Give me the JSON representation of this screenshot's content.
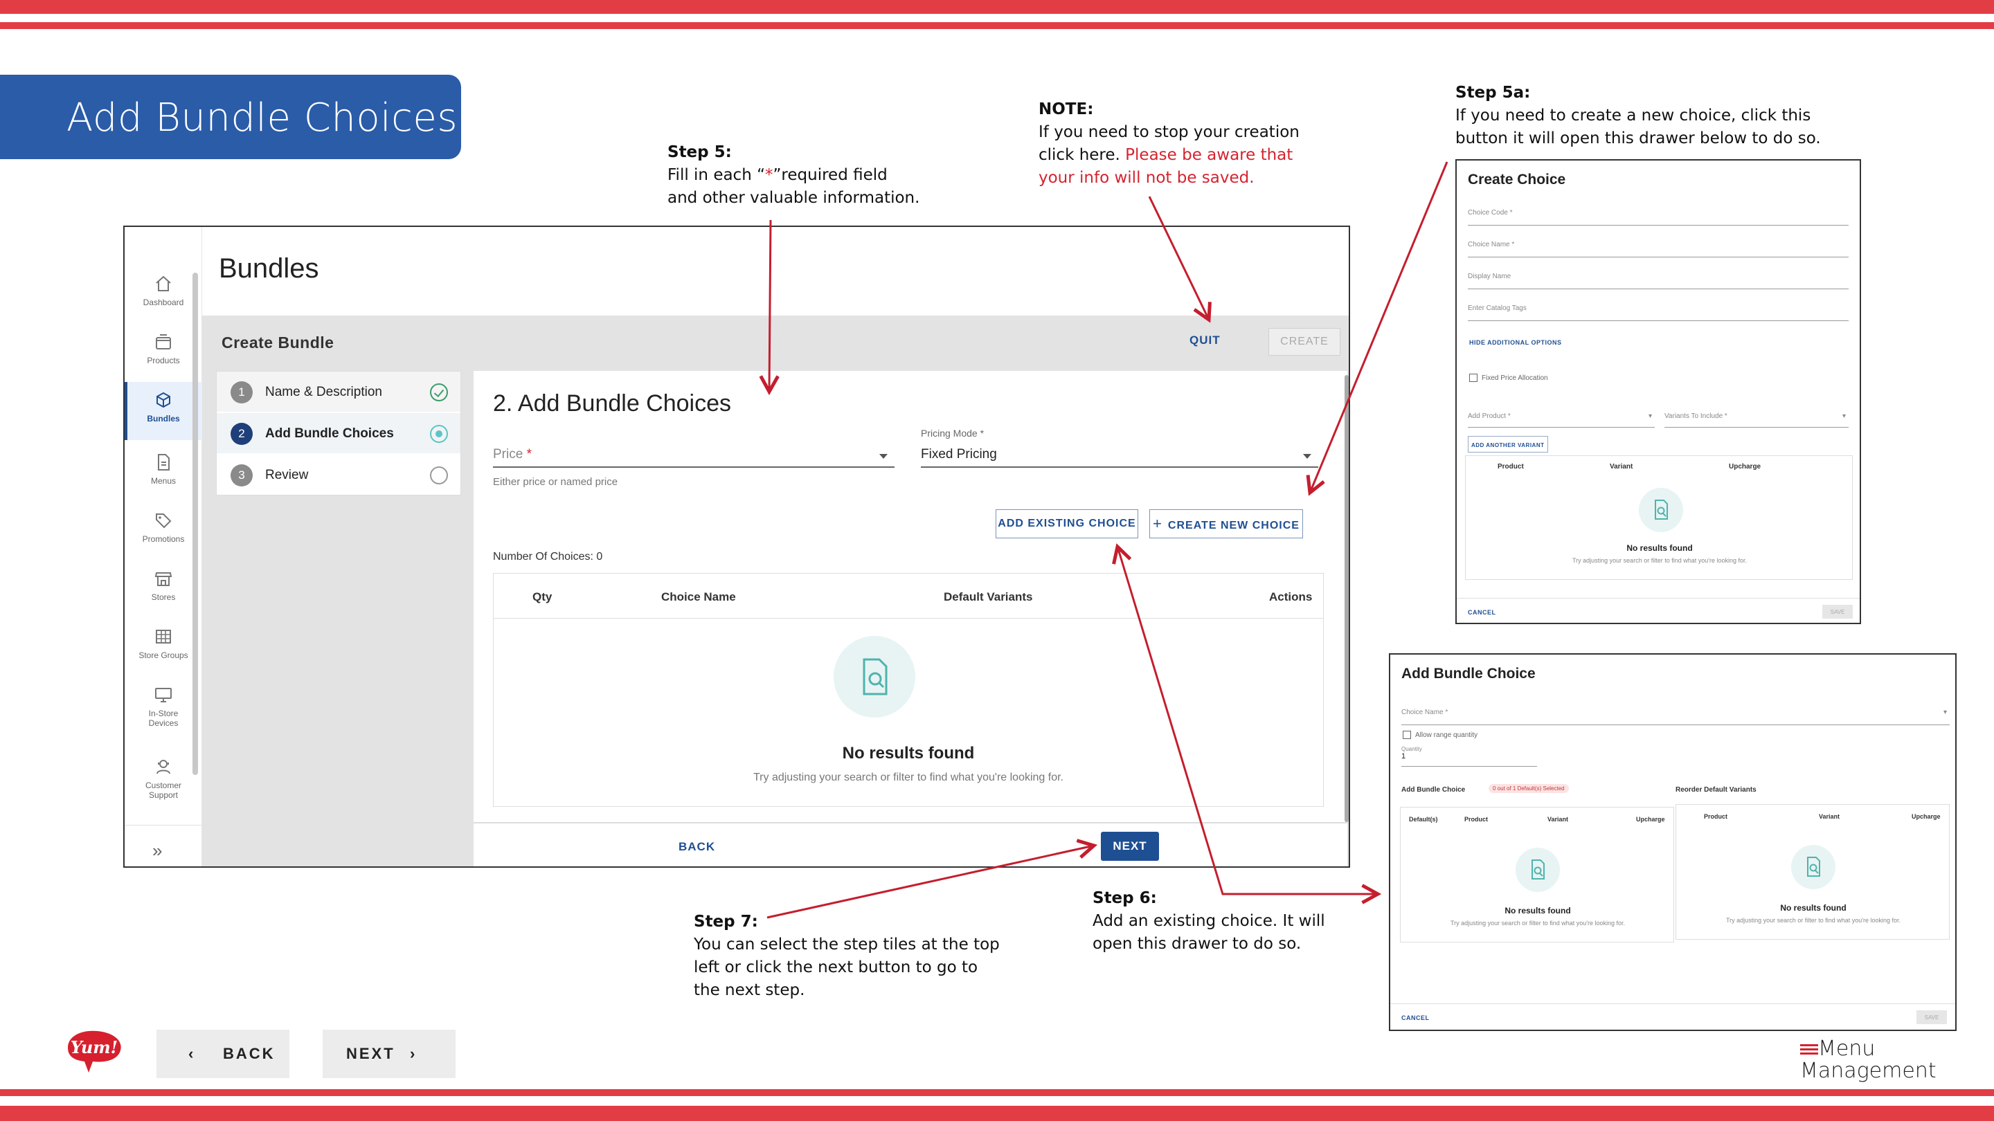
{
  "slide_title": "Add Bundle Choices",
  "annotations": {
    "step5": {
      "heading": "Step 5:",
      "line1_pre": "Fill in each “",
      "line1_star": "*",
      "line1_post": "”required field",
      "line2": "and other valuable information."
    },
    "note": {
      "heading": "NOTE:",
      "line1": "If you need to stop your creation",
      "line2_pre": "click here. ",
      "line2_red": "Please be aware that",
      "line3_red": "your info will not be saved."
    },
    "step5a": {
      "heading": "Step 5a:",
      "line1": "If you need to create a new choice, click this",
      "line2": "button it will open this drawer below to do so."
    },
    "step6": {
      "heading": "Step 6:",
      "line1": "Add an existing choice. It will",
      "line2": "open this drawer to do so."
    },
    "step7": {
      "heading": "Step 7:",
      "line1": "You can select the step tiles at the top",
      "line2": "left or click the next button to go to",
      "line3": "the next step."
    }
  },
  "app": {
    "sidebar": [
      {
        "label": "Dashboard",
        "icon": "home-icon"
      },
      {
        "label": "Products",
        "icon": "box-icon"
      },
      {
        "label": "Bundles",
        "icon": "cube-icon",
        "active": true
      },
      {
        "label": "Menus",
        "icon": "document-icon"
      },
      {
        "label": "Promotions",
        "icon": "tag-icon"
      },
      {
        "label": "Stores",
        "icon": "store-icon"
      },
      {
        "label": "Store Groups",
        "icon": "grid-icon"
      },
      {
        "label": "In-Store Devices",
        "line2": "Devices",
        "line1": "In-Store",
        "icon": "monitor-icon"
      },
      {
        "label": "Customer Support",
        "line1": "Customer",
        "line2": "Support",
        "icon": "support-icon"
      }
    ],
    "page_title": "Bundles",
    "header": {
      "title": "Create Bundle",
      "quit": "QUIT",
      "create": "CREATE"
    },
    "steps": [
      {
        "num": "1",
        "label": "Name & Description",
        "state": "done"
      },
      {
        "num": "2",
        "label": "Add Bundle Choices",
        "state": "active"
      },
      {
        "num": "3",
        "label": "Review",
        "state": "pending"
      }
    ],
    "panel": {
      "title": "2. Add Bundle Choices",
      "price_label": "Price",
      "price_required": "*",
      "price_helper": "Either price or named price",
      "pricing_mode_label": "Pricing Mode *",
      "pricing_mode_value": "Fixed Pricing",
      "add_existing": "ADD EXISTING CHOICE",
      "create_new": "CREATE NEW CHOICE",
      "num_choices": "Number Of Choices: 0",
      "columns": [
        "Qty",
        "Choice Name",
        "Default Variants",
        "Actions"
      ],
      "empty_title": "No results found",
      "empty_sub": "Try adjusting your search or filter to find what you're looking for."
    },
    "footer": {
      "back": "BACK",
      "next": "NEXT"
    }
  },
  "create_choice_drawer": {
    "title": "Create Choice",
    "fields": [
      "Choice Code *",
      "Choice Name *",
      "Display Name",
      "Enter Catalog Tags"
    ],
    "hide_options": "HIDE ADDITIONAL OPTIONS",
    "fixed_price": "Fixed Price Allocation",
    "add_product": "Add Product *",
    "variants_include": "Variants To Include *",
    "add_another": "ADD ANOTHER VARIANT",
    "columns": [
      "Product",
      "Variant",
      "Upcharge"
    ],
    "empty_title": "No results found",
    "empty_sub": "Try adjusting your search or filter to find what you're looking for.",
    "cancel": "CANCEL",
    "save": "SAVE"
  },
  "add_choice_drawer": {
    "title": "Add Bundle Choice",
    "choice_name": "Choice Name *",
    "allow_range": "Allow range quantity",
    "quantity_label": "Quantity",
    "quantity_value": "1",
    "left_heading": "Add Bundle Choice",
    "badge": "0 out of 1 Default(s) Selected",
    "right_heading": "Reorder Default Variants",
    "left_columns": [
      "Default(s)",
      "Product",
      "Variant",
      "Upcharge"
    ],
    "right_columns": [
      "Product",
      "Variant",
      "Upcharge"
    ],
    "empty_title": "No results found",
    "empty_sub": "Try adjusting your search or filter to find what you're looking for.",
    "cancel": "CANCEL",
    "save": "SAVE"
  },
  "bottom_nav": {
    "back": "BACK",
    "next": "NEXT"
  },
  "brand": {
    "yum": "Yum!",
    "mm_line1": "Menu",
    "mm_line2": "Management"
  },
  "colors": {
    "stripe": "#e23d45",
    "title_tab": "#2a5ca8",
    "primary": "#1f4f93",
    "arrow": "#c41e2e",
    "note_red": "#d5232f"
  }
}
